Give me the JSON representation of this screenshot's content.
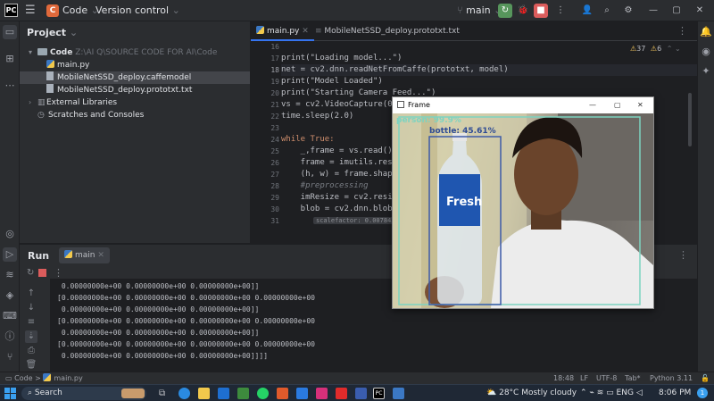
{
  "titlebar": {
    "logo": "PC",
    "project_badge": "C",
    "project": "Code",
    "vcs": "Version control",
    "branch": "main",
    "chevron": "⌄",
    "controls": {
      "minimize": "—",
      "maximize": "▢",
      "close": "✕"
    }
  },
  "project_panel": {
    "title": "Project",
    "items": [
      {
        "label": "Code",
        "path": "Z:\\AI Q\\SOURCE CODE FOR AI\\Code",
        "kind": "folder"
      },
      {
        "label": "main.py",
        "kind": "python"
      },
      {
        "label": "MobileNetSSD_deploy.caffemodel",
        "kind": "file"
      },
      {
        "label": "MobileNetSSD_deploy.prototxt.txt",
        "kind": "file"
      },
      {
        "label": "External Libraries",
        "kind": "lib"
      },
      {
        "label": "Scratches and Consoles",
        "kind": "scratch"
      }
    ]
  },
  "editor": {
    "tabs": [
      {
        "label": "main.py"
      },
      {
        "label": "MobileNetSSD_deploy.prototxt.txt"
      }
    ],
    "inspections": {
      "warnings": "37",
      "weak_warnings": "6"
    },
    "lines": [
      {
        "n": "16",
        "text": ""
      },
      {
        "n": "17",
        "text": "print(\"Loading model...\")"
      },
      {
        "n": "18",
        "text": "net = cv2.dnn.readNetFromCaffe(prototxt, model)"
      },
      {
        "n": "19",
        "text": "print(\"Model Loaded\")"
      },
      {
        "n": "20",
        "text": "print(\"Starting Camera Feed...\")"
      },
      {
        "n": "21",
        "text": "vs = cv2.VideoCapture(0)_#"
      },
      {
        "n": "22",
        "text": "time.sleep(2.0)"
      },
      {
        "n": "23",
        "text": ""
      },
      {
        "n": "24",
        "text": "while True:"
      },
      {
        "n": "25",
        "text": "    _,frame = vs.read()_#r"
      },
      {
        "n": "26",
        "text": "    frame = imutils.resize"
      },
      {
        "n": "27",
        "text": "    (h, w) = frame.shape[:"
      },
      {
        "n": "28",
        "text": "    #preprocessing"
      },
      {
        "n": "29",
        "text": "    imResize = cv2.resize(f"
      },
      {
        "n": "30",
        "text": "    blob = cv2.dnn.blobFrom"
      },
      {
        "n": "31",
        "text": "scalefactor: 0.007843"
      }
    ]
  },
  "run_panel": {
    "tab_run": "Run",
    "tab_config": "main",
    "output": [
      " 0.00000000e+00 0.00000000e+00 0.00000000e+00]]",
      "[0.00000000e+00 0.00000000e+00 0.00000000e+00 0.00000000e+00",
      " 0.00000000e+00 0.00000000e+00 0.00000000e+00]]",
      "[0.00000000e+00 0.00000000e+00 0.00000000e+00 0.00000000e+00",
      " 0.00000000e+00 0.00000000e+00 0.00000000e+00]]",
      "[0.00000000e+00 0.00000000e+00 0.00000000e+00 0.00000000e+00",
      " 0.00000000e+00 0.00000000e+00 0.00000000e+00]]]]"
    ]
  },
  "statusbar": {
    "breadcrumb_1": "Code",
    "breadcrumb_sep": ">",
    "breadcrumb_2": "main.py",
    "position": "18:48",
    "line_sep": "LF",
    "encoding": "UTF-8",
    "indent": "Tab*",
    "interpreter": "Python 3.11"
  },
  "frame_window": {
    "title": "Frame",
    "detections": [
      {
        "label": "person: 99.9%"
      },
      {
        "label": "bottle: 45.61%"
      }
    ],
    "bottle_text": "Fresh"
  },
  "taskbar": {
    "search": "Search",
    "weather_temp": "28°C",
    "weather_desc": "Mostly cloudy",
    "lang": "ENG",
    "time": "8:06 PM",
    "notification_count": "1"
  },
  "colors": {
    "accent": "#3574f0",
    "run_green": "#57965c",
    "stop_red": "#db5c5c",
    "box_person": "#7dd3c0",
    "box_bottle": "#3d5aa8"
  }
}
